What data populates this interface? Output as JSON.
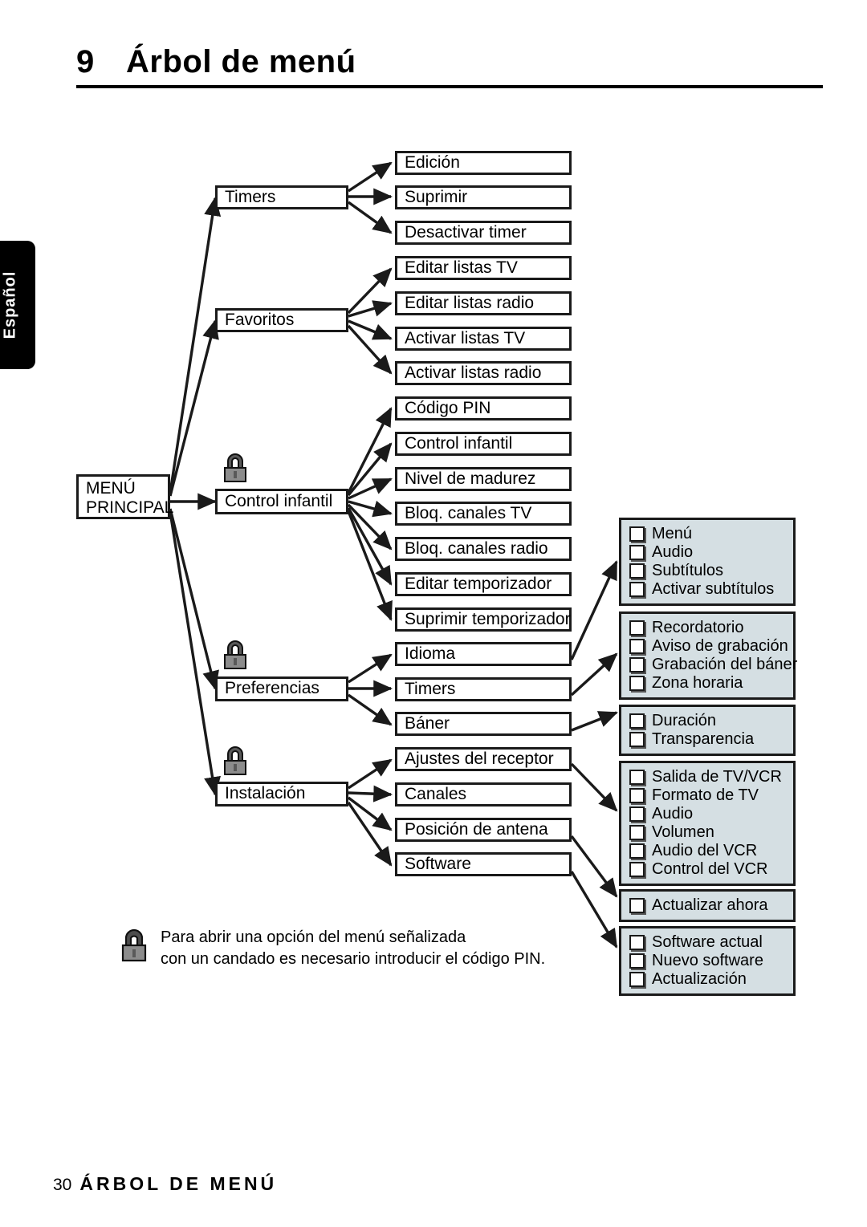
{
  "header": {
    "number": "9",
    "title": "Árbol de menú"
  },
  "side_tab": {
    "label": "Español"
  },
  "footer": {
    "page_number": "30",
    "label": "ÁRBOL DE MENÚ"
  },
  "footnote": {
    "icon": "padlock-icon",
    "line1": "Para abrir una opción del menú señalizada",
    "line2": "con un candado es necesario introducir el código PIN."
  },
  "colors": {
    "node_border": "#1a1a1a",
    "node_fill": "#ffffff",
    "group_fill": "#d5dfe3",
    "tab_fill": "#000000"
  },
  "diagram": {
    "root": {
      "line1": "MENÚ",
      "line2": "PRINCIPAL"
    },
    "level1": [
      {
        "label": "Timers",
        "locked": false
      },
      {
        "label": "Favoritos",
        "locked": false
      },
      {
        "label": "Control infantil",
        "locked": true
      },
      {
        "label": "Preferencias",
        "locked": true
      },
      {
        "label": "Instalación",
        "locked": true
      }
    ],
    "level2": {
      "timers": [
        "Edición",
        "Suprimir",
        "Desactivar timer"
      ],
      "favoritos": [
        "Editar listas TV",
        "Editar listas radio",
        "Activar listas TV",
        "Activar listas radio"
      ],
      "control_infantil": [
        "Código PIN",
        "Control infantil",
        "Nivel de madurez",
        "Bloq. canales TV",
        "Bloq. canales radio",
        "Editar temporizador",
        "Suprimir temporizador"
      ],
      "preferencias": [
        "Idioma",
        "Timers",
        "Báner"
      ],
      "instalacion": [
        "Ajustes del receptor",
        "Canales",
        "Posición de antena",
        "Software"
      ]
    },
    "level3": [
      {
        "name": "idioma-options",
        "items": [
          "Menú",
          "Audio",
          "Subtítulos",
          "Activar subtítulos"
        ]
      },
      {
        "name": "timers-options",
        "items": [
          "Recordatorio",
          "Aviso de grabación",
          "Grabación del báner",
          "Zona horaria"
        ]
      },
      {
        "name": "baner-options",
        "items": [
          "Duración",
          "Transparencia"
        ]
      },
      {
        "name": "ajustes-options",
        "items": [
          "Salida de TV/VCR",
          "Formato de TV",
          "Audio",
          "Volumen",
          "Audio del VCR",
          "Control del VCR"
        ]
      },
      {
        "name": "antena-options",
        "items": [
          "Actualizar ahora"
        ]
      },
      {
        "name": "software-options",
        "items": [
          "Software actual",
          "Nuevo software",
          "Actualización"
        ]
      }
    ]
  }
}
